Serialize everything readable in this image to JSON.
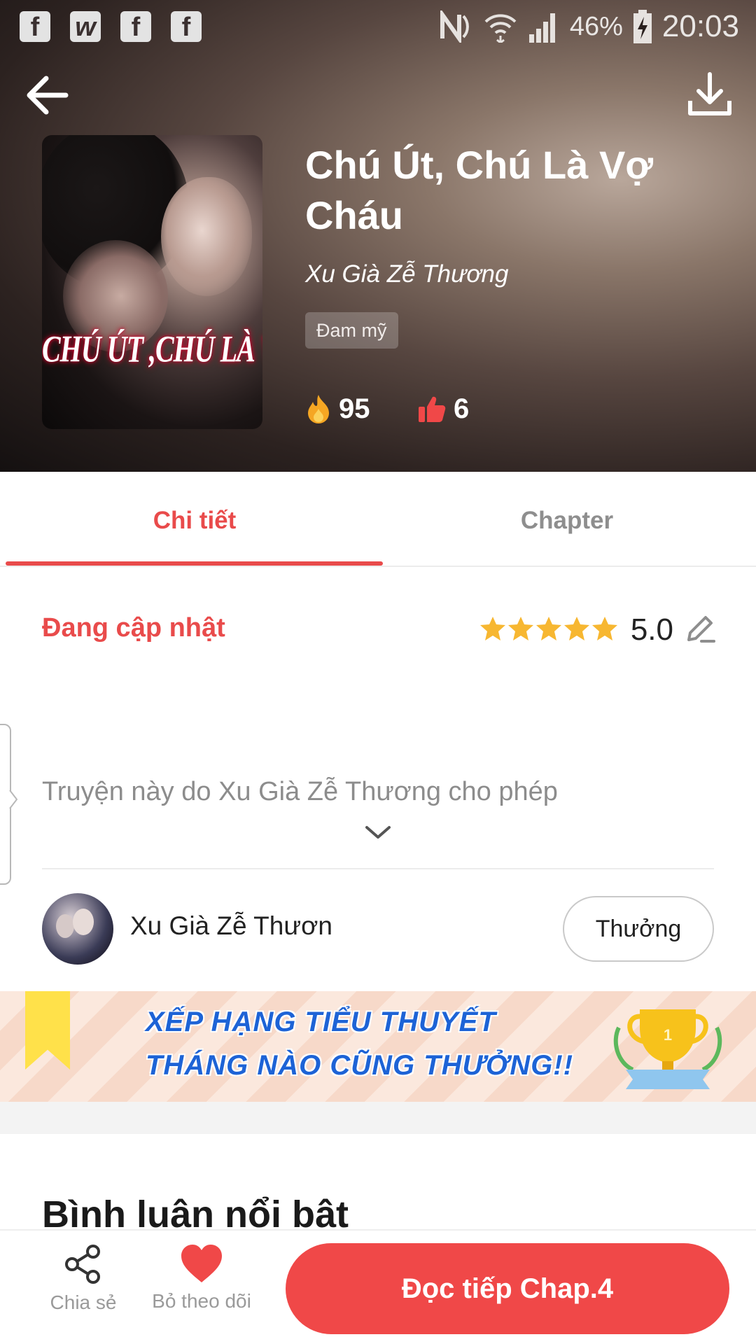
{
  "statusbar": {
    "apps": [
      "f",
      "w",
      "f",
      "f"
    ],
    "battery_percent": "46%",
    "time": "20:03",
    "icons": [
      "nfc-icon",
      "wifi-icon",
      "signal-icon",
      "battery-charging-icon"
    ]
  },
  "header": {
    "back_icon": "arrow-left-icon",
    "download_icon": "download-icon",
    "cover_title": "CHÚ ÚT ,CHÚ LÀ VỢ CHÁU",
    "title": "Chú Út, Chú Là Vợ Cháu",
    "author": "Xu Già Zễ Thương",
    "genre": "Đam mỹ",
    "views": "95",
    "likes": "6"
  },
  "tabs": {
    "details": "Chi tiết",
    "chapter": "Chapter",
    "active": "details"
  },
  "details": {
    "status": "Đang cập nhật",
    "stars": 5,
    "rating": "5.0",
    "description": "Truyện này do Xu Già Zễ Thương cho phép"
  },
  "author_row": {
    "name": "Xu Già Zễ Thươn",
    "reward_label": "Thưởng"
  },
  "banner": {
    "line1": "XẾP HẠNG TIỂU THUYẾT",
    "line2": "THÁNG NÀO CŨNG THƯỞNG!!"
  },
  "comments": {
    "title": "Bình luận nổi bật"
  },
  "bottombar": {
    "share_label": "Chia sẻ",
    "follow_label": "Bỏ theo dõi",
    "read_label": "Đọc tiếp Chap.4"
  },
  "colors": {
    "accent": "#f04848",
    "tab_active": "#e94b4b",
    "star": "#f7b731",
    "flame": "#f5a623"
  }
}
